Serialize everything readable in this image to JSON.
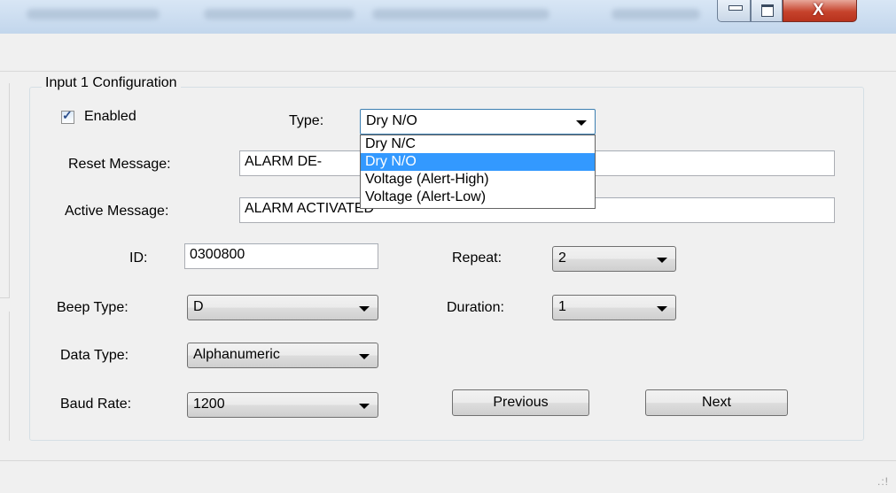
{
  "window": {
    "close_glyph": "X"
  },
  "group": {
    "title": "Input 1 Configuration"
  },
  "enabled": {
    "label": "Enabled",
    "checked": true,
    "check_glyph": "✓"
  },
  "type": {
    "label": "Type:",
    "value": "Dry N/O",
    "options": [
      "Dry N/C",
      "Dry N/O",
      "Voltage (Alert-High)",
      "Voltage (Alert-Low)"
    ],
    "selected_index": 1
  },
  "reset_message": {
    "label": "Reset Message:",
    "value": "ALARM DE-"
  },
  "active_message": {
    "label": "Active Message:",
    "value": "ALARM ACTIVATED"
  },
  "id": {
    "label": "ID:",
    "value": "0300800"
  },
  "repeat": {
    "label": "Repeat:",
    "value": "2"
  },
  "beep_type": {
    "label": "Beep Type:",
    "value": "D"
  },
  "duration": {
    "label": "Duration:",
    "value": "1"
  },
  "data_type": {
    "label": "Data Type:",
    "value": "Alphanumeric"
  },
  "baud_rate": {
    "label": "Baud Rate:",
    "value": "1200"
  },
  "buttons": {
    "previous": "Previous",
    "next": "Next"
  },
  "status": {
    "grip_glyph": ".:!"
  },
  "colors": {
    "selection": "#3399ff",
    "titlebar": "#c9daed",
    "close_button": "#c6432c"
  }
}
